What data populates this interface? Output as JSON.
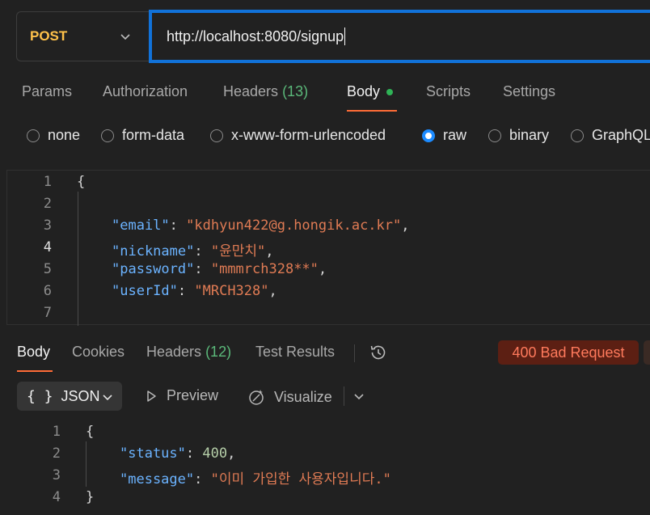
{
  "request": {
    "method": "POST",
    "url": "http://localhost:8080/signup"
  },
  "request_tabs": {
    "params": "Params",
    "authorization": "Authorization",
    "headers": "Headers",
    "headers_count": "(13)",
    "body": "Body",
    "scripts": "Scripts",
    "settings": "Settings"
  },
  "body_types": {
    "none": "none",
    "form_data": "form-data",
    "urlencoded": "x-www-form-urlencoded",
    "raw": "raw",
    "binary": "binary",
    "graphql": "GraphQL",
    "selected": "raw"
  },
  "request_body": {
    "line_numbers": [
      "1",
      "2",
      "3",
      "4",
      "5",
      "6",
      "7"
    ],
    "open_brace": "{",
    "fields": [
      {
        "key": "\"email\"",
        "sep": ": ",
        "value": "\"kdhyun422@g.hongik.ac.kr\"",
        "end": ","
      },
      {
        "key": "\"nickname\"",
        "sep": ": ",
        "value": "\"윤만치\"",
        "end": ","
      },
      {
        "key": "\"password\"",
        "sep": ": ",
        "value": "\"mmmrch328**\"",
        "end": ","
      },
      {
        "key": "\"userId\"",
        "sep": ": ",
        "value": "\"MRCH328\"",
        "end": ","
      }
    ]
  },
  "response_tabs": {
    "body": "Body",
    "cookies": "Cookies",
    "headers": "Headers",
    "headers_count": "(12)",
    "test_results": "Test Results"
  },
  "response_status": "400 Bad Request",
  "response_toolbar": {
    "format_braces": "{ }",
    "format": "JSON",
    "preview": "Preview",
    "visualize": "Visualize"
  },
  "response_body": {
    "line_numbers": [
      "1",
      "2",
      "3",
      "4"
    ],
    "open_brace": "{",
    "close_brace": "}",
    "status_key": "\"status\"",
    "status_value": "400",
    "message_key": "\"message\"",
    "message_value": "\"이미 가입한 사용자입니다.\"",
    "sep": ": ",
    "comma": ","
  },
  "colors": {
    "method": "#ffc24a",
    "url_focus_border": "#1172d9",
    "active_tab_underline": "#ff6c37",
    "json_key": "#6bb3ff",
    "json_string": "#e07b54",
    "status_error_bg": "#5c1f13",
    "status_error_text": "#ff7a5c"
  },
  "icons": [
    "chevron-down-icon",
    "history-icon",
    "play-icon",
    "visualize-icon",
    "radio-icon"
  ]
}
